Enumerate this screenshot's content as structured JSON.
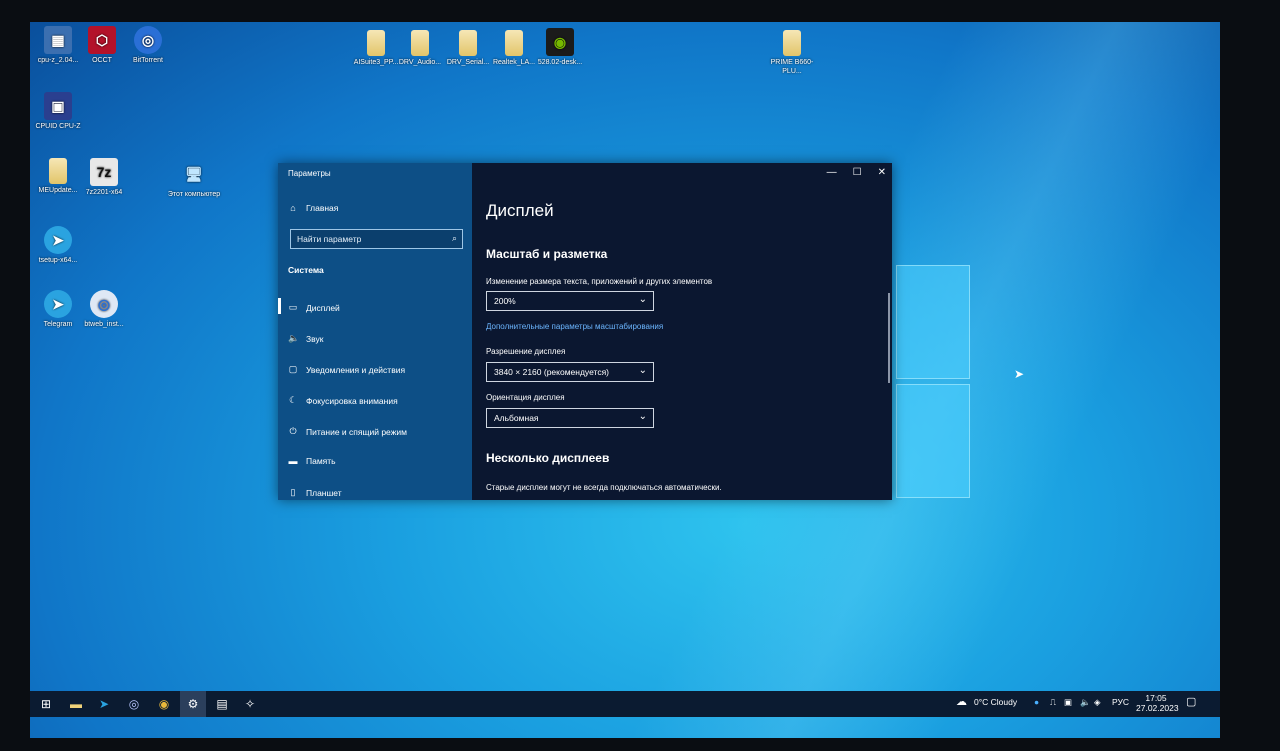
{
  "desktop_icons": [
    {
      "label": "cpu-z_2.04...",
      "glyph": "cpu"
    },
    {
      "label": "OCCT",
      "glyph": "O"
    },
    {
      "label": "BitTorrent",
      "glyph": "bt"
    },
    {
      "label": "CPUID CPU-Z",
      "glyph": "cpu"
    },
    {
      "label": "MEUpdate...",
      "glyph": "folder"
    },
    {
      "label": "7z2201-x64",
      "glyph": "7z"
    },
    {
      "label": "Этот компьютер",
      "glyph": "pc"
    },
    {
      "label": "tsetup-x64...",
      "glyph": "tg"
    },
    {
      "label": "Telegram",
      "glyph": "tg"
    },
    {
      "label": "btweb_inst...",
      "glyph": "bt"
    },
    {
      "label": "AISuite3_PP...",
      "glyph": "folder"
    },
    {
      "label": "DRV_Audio...",
      "glyph": "folder"
    },
    {
      "label": "DRV_Serial...",
      "glyph": "folder"
    },
    {
      "label": "Realtek_LA...",
      "glyph": "folder"
    },
    {
      "label": "528.02-desk...",
      "glyph": "nv"
    },
    {
      "label": "PRIME B660-PLU...",
      "glyph": "folder"
    }
  ],
  "window": {
    "title": "Параметры",
    "minimize": "—",
    "maximize": "☐",
    "close": "✕",
    "sidebar": {
      "home": "Главная",
      "search_placeholder": "Найти параметр",
      "section": "Система",
      "items": [
        {
          "label": "Дисплей",
          "icon": "monitor-icon"
        },
        {
          "label": "Звук",
          "icon": "speaker-icon"
        },
        {
          "label": "Уведомления и действия",
          "icon": "notification-icon"
        },
        {
          "label": "Фокусировка внимания",
          "icon": "moon-icon"
        },
        {
          "label": "Питание и спящий режим",
          "icon": "power-icon"
        },
        {
          "label": "Память",
          "icon": "storage-icon"
        },
        {
          "label": "Планшет",
          "icon": "tablet-icon"
        }
      ]
    },
    "main": {
      "title": "Дисплей",
      "scale_heading": "Масштаб и разметка",
      "scale_label": "Изменение размера текста, приложений и других элементов",
      "scale_value": "200%",
      "scale_link": "Дополнительные параметры масштабирования",
      "resolution_label": "Разрешение дисплея",
      "resolution_value": "3840 × 2160 (рекомендуется)",
      "orientation_label": "Ориентация дисплея",
      "orientation_value": "Альбомная",
      "multi_heading": "Несколько дисплеев",
      "multi_text": "Старые дисплеи могут не всегда подключаться автоматически."
    }
  },
  "taskbar": {
    "weather": "0°C  Cloudy",
    "lang": "РУС",
    "time": "17:05",
    "date": "27.02.2023"
  },
  "colors": {
    "accent": "#0d4f86",
    "window_bg": "#0b1730",
    "taskbar": "#0b1b31"
  }
}
